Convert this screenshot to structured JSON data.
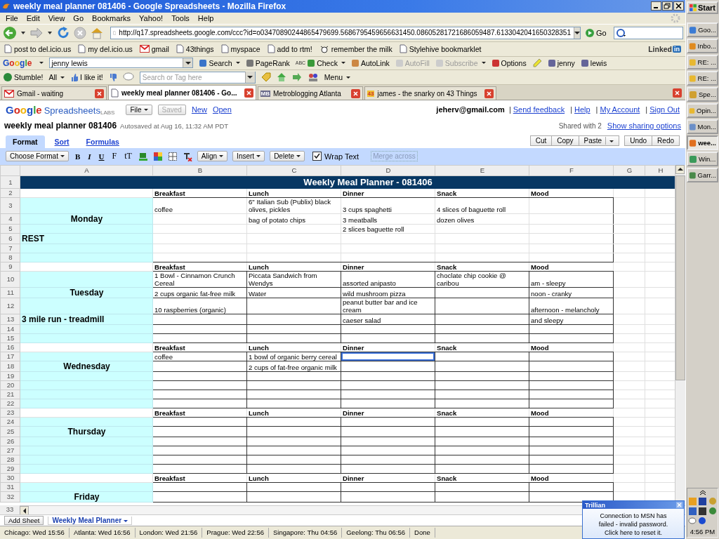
{
  "window": {
    "title": "weekly meal planner 081406 - Google Spreadsheets - Mozilla Firefox"
  },
  "menu": [
    "File",
    "Edit",
    "View",
    "Go",
    "Bookmarks",
    "Yahoo!",
    "Tools",
    "Help"
  ],
  "nav": {
    "url": "http://q17.spreadsheets.google.com/ccc?id=o03470890244865479699.5686795459656631450.08605281721686059487.6133042041650328351",
    "go": "Go"
  },
  "bookmarks": [
    "post to del.icio.us",
    "my del.icio.us",
    "gmail",
    "43things",
    "myspace",
    "add to rtm!",
    "remember the milk",
    "Stylehive bookmarklet"
  ],
  "linkedin": {
    "text": "Linked",
    "badge": "in"
  },
  "google_toolbar": {
    "logo": "Google",
    "query": "jenny lewis",
    "items": [
      {
        "label": "Search",
        "disabled": false,
        "dropdown": true
      },
      {
        "label": "PageRank",
        "disabled": false,
        "dropdown": false
      },
      {
        "label": "Check",
        "badge": "ABC",
        "disabled": false,
        "dropdown": true
      },
      {
        "label": "AutoLink",
        "disabled": false,
        "dropdown": false
      },
      {
        "label": "AutoFill",
        "disabled": true,
        "dropdown": false
      },
      {
        "label": "Subscribe",
        "disabled": true,
        "dropdown": true
      },
      {
        "label": "Options",
        "disabled": false,
        "dropdown": false
      },
      {
        "label": "jenny",
        "disabled": false,
        "dropdown": false
      },
      {
        "label": "lewis",
        "disabled": false,
        "dropdown": false
      }
    ]
  },
  "stumble_toolbar": {
    "stumble": "Stumble!",
    "all": "All",
    "like": "I like it!",
    "search_placeholder": "Search or Tag here",
    "menu": "Menu"
  },
  "tabs": [
    {
      "label": "Gmail - waiting",
      "selected": false,
      "kind": "mail"
    },
    {
      "label": "weekly meal planner 081406 - Go...",
      "selected": true,
      "kind": "doc"
    },
    {
      "label": "Metroblogging Atlanta",
      "selected": false,
      "kind": "badge",
      "badge": "MB"
    },
    {
      "label": "james - the snarky on 43 Things",
      "selected": false,
      "kind": "badge",
      "badge": "43"
    }
  ],
  "app": {
    "logo": "Google",
    "product": "Spreadsheets",
    "labs": "LABS",
    "file": "File",
    "saved": {
      "label": "Saved",
      "disabled": true
    },
    "links": [
      "New",
      "Open"
    ],
    "user": "jeherv@gmail.com",
    "separators": [
      "|",
      "|",
      "|",
      "|"
    ],
    "account_links": [
      "Send feedback",
      "Help",
      "My Account",
      "Sign Out"
    ]
  },
  "document": {
    "title": "weekly meal planner 081406",
    "autosave": "Autosaved at Aug 16, 11:32 AM PDT",
    "shared": "Shared with 2",
    "sharing_link": "Show sharing options"
  },
  "app_tabs": [
    {
      "label": "Format",
      "selected": true
    },
    {
      "label": "Sort",
      "selected": false
    },
    {
      "label": "Formulas",
      "selected": false
    }
  ],
  "clipboard_buttons": [
    {
      "label": "Cut",
      "dropdown": false
    },
    {
      "label": "Copy",
      "dropdown": false
    },
    {
      "label": "Paste",
      "dropdown": true
    }
  ],
  "history_buttons": [
    "Undo",
    "Redo"
  ],
  "format_toolbar": {
    "choose_format": "Choose Format",
    "style_buttons": [
      "B",
      "I",
      "U"
    ],
    "font_buttons": [
      "F",
      "tT"
    ],
    "menus": [
      "Align",
      "Insert",
      "Delete"
    ],
    "wrap_text": {
      "label": "Wrap Text",
      "checked": true
    },
    "merge": {
      "label": "Merge across",
      "disabled": true
    }
  },
  "sheet": {
    "columns": [
      "A",
      "B",
      "C",
      "D",
      "E",
      "F",
      "G",
      "H"
    ],
    "title_number": "1",
    "title": "Weekly Meal Planner - 081406",
    "last_number": "33",
    "blocks": [
      {
        "day": "Monday",
        "note": "REST",
        "kind": "outline",
        "header": {
          "number": "2",
          "cells": [
            "Breakfast",
            "Lunch",
            "Dinner",
            "Snack",
            "Mood"
          ]
        },
        "rows": [
          {
            "number": "3",
            "cells": [
              "coffee",
              "6\" Italian Sub (Publix) black olives, pickles",
              "3 cups spaghetti",
              "4 slices of baguette roll",
              null
            ],
            "selected": [
              false,
              false,
              false,
              false,
              false
            ]
          },
          {
            "number": "4",
            "cells": [
              null,
              "bag of potato chips",
              "3 meatballs",
              "dozen olives",
              null
            ],
            "selected": [
              false,
              false,
              false,
              false,
              false
            ]
          },
          {
            "number": "5",
            "cells": [
              null,
              null,
              "2 slices baguette roll",
              null,
              null
            ],
            "selected": [
              false,
              false,
              false,
              false,
              false
            ]
          },
          {
            "number": "6",
            "cells": [
              null,
              null,
              null,
              null,
              null
            ],
            "selected": [
              false,
              false,
              false,
              false,
              false
            ]
          },
          {
            "number": "7",
            "cells": [
              null,
              null,
              null,
              null,
              null
            ],
            "selected": [
              false,
              false,
              false,
              false,
              false
            ]
          },
          {
            "number": "8",
            "cells": [
              null,
              null,
              null,
              null,
              null
            ],
            "selected": [
              false,
              false,
              false,
              false,
              false
            ]
          }
        ]
      },
      {
        "day": "Tuesday",
        "note": "3 mile run - treadmill",
        "kind": "grid",
        "header": {
          "number": "9",
          "cells": [
            "Breakfast",
            "Lunch",
            "Dinner",
            "Snack",
            "Mood"
          ]
        },
        "rows": [
          {
            "number": "10",
            "cells": [
              "1 Bowl - Cinnamon Crunch Cereal",
              "Piccata Sandwich from Wendys",
              "assorted anipasto",
              "choclate chip cookie @ caribou",
              "am - sleepy"
            ],
            "selected": [
              false,
              false,
              false,
              false,
              false
            ]
          },
          {
            "number": "11",
            "cells": [
              "2 cups organic fat-free milk",
              "Water",
              "wild mushroom pizza",
              null,
              "noon - cranky"
            ],
            "selected": [
              false,
              false,
              false,
              false,
              false
            ]
          },
          {
            "number": "12",
            "cells": [
              "10 raspberries (organic)",
              null,
              "peanut butter bar and ice cream",
              null,
              "afternoon - melancholy"
            ],
            "selected": [
              false,
              false,
              false,
              false,
              false
            ]
          },
          {
            "number": "13",
            "cells": [
              null,
              null,
              "caeser salad",
              null,
              "and sleepy"
            ],
            "selected": [
              false,
              false,
              false,
              false,
              false
            ]
          },
          {
            "number": "14",
            "cells": [
              null,
              null,
              null,
              null,
              null
            ],
            "selected": [
              false,
              false,
              false,
              false,
              false
            ]
          },
          {
            "number": "15",
            "cells": [
              null,
              null,
              null,
              null,
              null
            ],
            "selected": [
              false,
              false,
              false,
              false,
              false
            ]
          }
        ]
      },
      {
        "day": "Wednesday",
        "kind": "grid",
        "header": {
          "number": "16",
          "cells": [
            "Breakfast",
            "Lunch",
            "Dinner",
            "Snack",
            "Mood"
          ]
        },
        "rows": [
          {
            "number": "17",
            "cells": [
              "coffee",
              "1 bowl of organic berry cereal",
              null,
              null,
              null
            ],
            "selected": [
              false,
              false,
              true,
              false,
              false
            ]
          },
          {
            "number": "18",
            "cells": [
              null,
              "2 cups of fat-free organic milk",
              null,
              null,
              null
            ],
            "selected": [
              false,
              false,
              false,
              false,
              false
            ]
          },
          {
            "number": "19",
            "cells": [
              null,
              null,
              null,
              null,
              null
            ],
            "selected": [
              false,
              false,
              false,
              false,
              false
            ]
          },
          {
            "number": "20",
            "cells": [
              null,
              null,
              null,
              null,
              null
            ],
            "selected": [
              false,
              false,
              false,
              false,
              false
            ]
          },
          {
            "number": "21",
            "cells": [
              null,
              null,
              null,
              null,
              null
            ],
            "selected": [
              false,
              false,
              false,
              false,
              false
            ]
          },
          {
            "number": "22",
            "cells": [
              null,
              null,
              null,
              null,
              null
            ],
            "selected": [
              false,
              false,
              false,
              false,
              false
            ]
          }
        ]
      },
      {
        "day": "Thursday",
        "kind": "grid",
        "header": {
          "number": "23",
          "cells": [
            "Breakfast",
            "Lunch",
            "Dinner",
            "Snack",
            "Mood"
          ]
        },
        "rows": [
          {
            "number": "24",
            "cells": [
              null,
              null,
              null,
              null,
              null
            ],
            "selected": [
              false,
              false,
              false,
              false,
              false
            ]
          },
          {
            "number": "25",
            "cells": [
              null,
              null,
              null,
              null,
              null
            ],
            "selected": [
              false,
              false,
              false,
              false,
              false
            ]
          },
          {
            "number": "26",
            "cells": [
              null,
              null,
              null,
              null,
              null
            ],
            "selected": [
              false,
              false,
              false,
              false,
              false
            ]
          },
          {
            "number": "27",
            "cells": [
              null,
              null,
              null,
              null,
              null
            ],
            "selected": [
              false,
              false,
              false,
              false,
              false
            ]
          },
          {
            "number": "28",
            "cells": [
              null,
              null,
              null,
              null,
              null
            ],
            "selected": [
              false,
              false,
              false,
              false,
              false
            ]
          },
          {
            "number": "29",
            "cells": [
              null,
              null,
              null,
              null,
              null
            ],
            "selected": [
              false,
              false,
              false,
              false,
              false
            ]
          }
        ]
      },
      {
        "day": "Friday",
        "kind": "grid",
        "header": {
          "number": "30",
          "cells": [
            "Breakfast",
            "Lunch",
            "Dinner",
            "Snack",
            "Mood"
          ]
        },
        "rows": [
          {
            "number": "31",
            "cells": [
              null,
              null,
              null,
              null,
              null
            ],
            "selected": [
              false,
              false,
              false,
              false,
              false
            ]
          },
          {
            "number": "32",
            "cells": [
              null,
              null,
              null,
              null,
              null
            ],
            "selected": [
              false,
              false,
              false,
              false,
              false
            ]
          }
        ]
      }
    ]
  },
  "sheet_tabs": {
    "add": "Add Sheet",
    "tabs": [
      {
        "label": "Weekly Meal Planner",
        "selected": true
      }
    ]
  },
  "status_bar": {
    "clocks": [
      "Chicago: Wed 15:56",
      "Atlanta: Wed 16:56",
      "London: Wed 21:56",
      "Prague: Wed 22:56",
      "Singapore: Thu 04:56",
      "Geelong: Thu 06:56"
    ],
    "status": "Done"
  },
  "notification": {
    "title": "Trillian",
    "message": "Connection to MSN has failed - invalid password. Click here to reset it."
  },
  "taskbar": {
    "start": "Start",
    "items": [
      {
        "label": "Goo...",
        "selected": false
      },
      {
        "label": "Inbo...",
        "selected": false
      },
      {
        "label": "RE: ...",
        "selected": false
      },
      {
        "label": "RE: ...",
        "selected": false
      },
      {
        "label": "Spe...",
        "selected": false
      },
      {
        "label": "Opin...",
        "selected": false
      },
      {
        "label": "Mon...",
        "selected": false
      },
      {
        "label": "wee...",
        "selected": true
      },
      {
        "label": "Win...",
        "selected": false
      },
      {
        "label": "Garr...",
        "selected": false
      }
    ],
    "clock": "4:56 PM"
  }
}
